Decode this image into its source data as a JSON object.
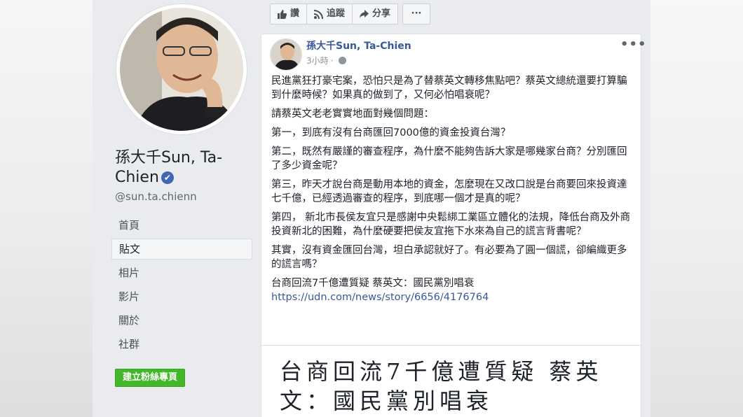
{
  "page": {
    "name": "孫大千Sun, Ta-Chien",
    "handle": "@sun.ta.chienn",
    "verified_mark": "✔"
  },
  "nav": {
    "items": [
      "首頁",
      "貼文",
      "相片",
      "影片",
      "關於",
      "社群"
    ],
    "active": "貼文"
  },
  "create_button": "建立粉絲專頁",
  "actions": {
    "like": "讚",
    "follow": "追蹤",
    "share": "分享",
    "more": "···"
  },
  "post": {
    "author": "孫大千Sun, Ta-Chien",
    "time": "3小時",
    "more": "•••",
    "paragraphs": [
      "民進黨狂打豪宅案，恐怕只是為了替蔡英文轉移焦點吧？蔡英文總統還要打算騙到什麼時候？如果真的做到了，又何必怕唱衰呢？",
      "請蔡英文老老實實地面對幾個問題：",
      "第一，到底有沒有台商匯回7000億的資金投資台灣？",
      "第二，既然有嚴謹的審查程序，為什麼不能夠告訴大家是哪幾家台商？分別匯回了多少資金呢？",
      "第三，昨天才說台商是動用本地的資金，怎麼現在又改口說是台商要回來投資達七千億，已經透過審查的程序，到底哪一個才是真的呢？",
      "第四， 新北市長侯友宜只是感謝中央鬆綁工業區立體化的法規，降低台商及外商投資新北的困難，為什麼硬要把侯友宜拖下水來為自己的謊言背書呢？",
      "其實，沒有資金匯回台灣，坦白承認就好了。有必要為了圓一個謊，卻編織更多的謊言嗎？"
    ],
    "link_title": "台商回流7千億遭質疑 蔡英文：國民黨別唱衰",
    "link_url": "https://udn.com/news/story/6656/4176764",
    "preview_headline": "台商回流7千億遭質疑 蔡英文：國民黨別唱衰"
  },
  "colors": {
    "link_blue": "#385898",
    "page_bg": "#e9ebee",
    "green_button": "#42b72a",
    "verified_blue": "#4267b2"
  },
  "icons": [
    "like-icon",
    "rss-icon",
    "share-icon",
    "more-icon",
    "globe-icon",
    "verified-icon"
  ]
}
